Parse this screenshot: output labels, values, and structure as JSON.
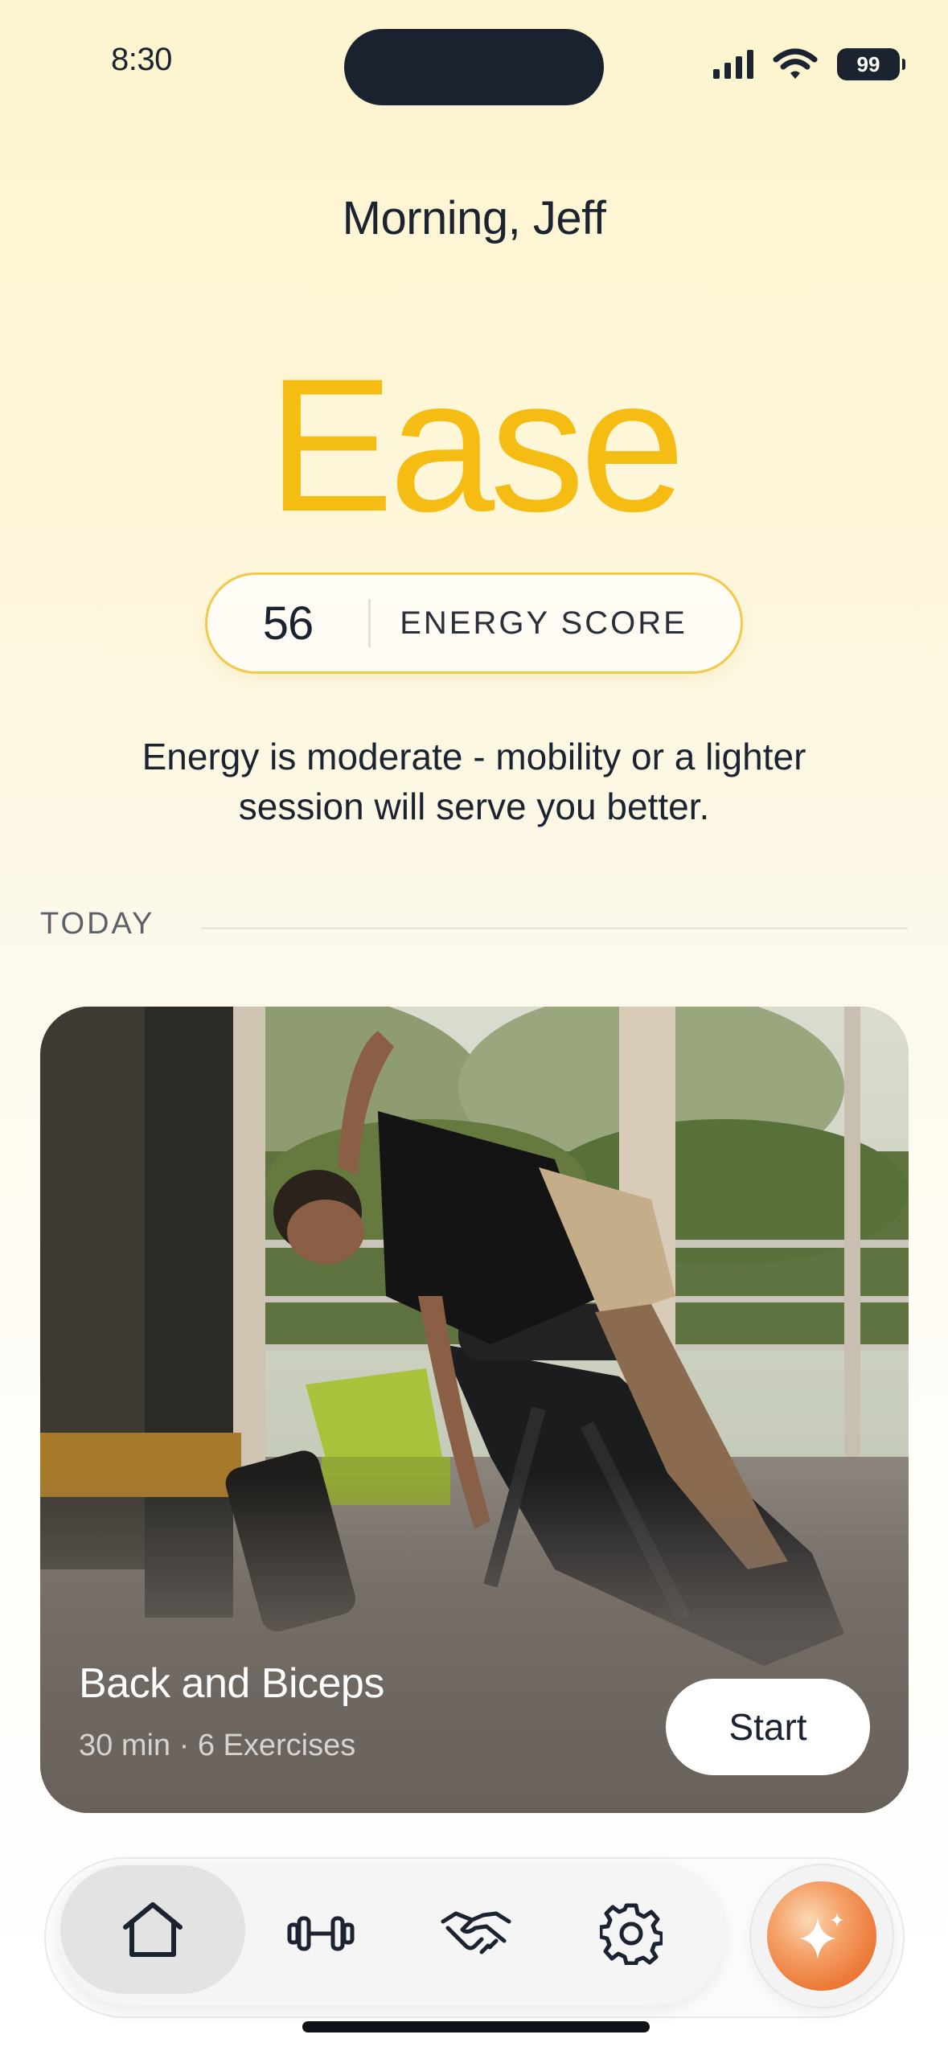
{
  "status_bar": {
    "time": "8:30",
    "battery": "99"
  },
  "greeting": "Morning, Jeff",
  "state_word": "Ease",
  "energy": {
    "score": "56",
    "label": "ENERGY SCORE"
  },
  "advice": "Energy is moderate - mobility or a lighter session will serve you better.",
  "section": {
    "today_label": "TODAY"
  },
  "workout": {
    "title": "Back and Biceps",
    "meta": "30 min · 6 Exercises",
    "start_label": "Start"
  },
  "nav": {
    "items": [
      {
        "icon": "home-icon",
        "active": true
      },
      {
        "icon": "dumbbell-icon",
        "active": false
      },
      {
        "icon": "handshake-icon",
        "active": false
      },
      {
        "icon": "gear-icon",
        "active": false
      }
    ],
    "assistant_icon": "sparkle-icon"
  },
  "colors": {
    "accent": "#f5bd14",
    "text": "#1b2330",
    "assistant": "#ec7b3a"
  }
}
